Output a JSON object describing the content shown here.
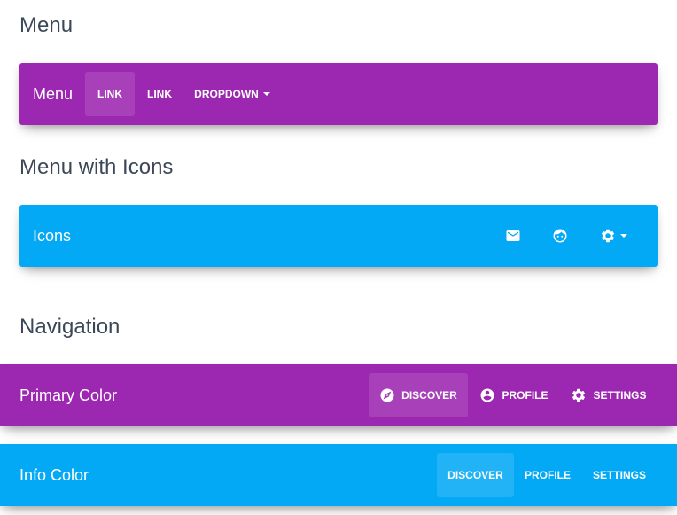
{
  "sections": {
    "menu": "Menu",
    "menu_icons": "Menu with Icons",
    "navigation": "Navigation"
  },
  "menu_bar": {
    "brand": "Menu",
    "links": [
      "LINK",
      "LINK",
      "DROPDOWN"
    ],
    "active_index": 0,
    "color": "#9c27b0"
  },
  "icons_bar": {
    "brand": "Icons",
    "icons": [
      "email-icon",
      "face-icon",
      "settings-icon"
    ],
    "color": "#03a9f4"
  },
  "primary_bar": {
    "brand": "Primary Color",
    "items": [
      {
        "label": "DISCOVER",
        "icon": "explore-icon"
      },
      {
        "label": "PROFILE",
        "icon": "account-circle-icon"
      },
      {
        "label": "SETTINGS",
        "icon": "settings-icon"
      }
    ],
    "active_index": 0,
    "color": "#9c27b0"
  },
  "info_bar": {
    "brand": "Info Color",
    "items": [
      {
        "label": "DISCOVER"
      },
      {
        "label": "PROFILE"
      },
      {
        "label": "SETTINGS"
      }
    ],
    "active_index": 0,
    "color": "#03a9f4"
  }
}
